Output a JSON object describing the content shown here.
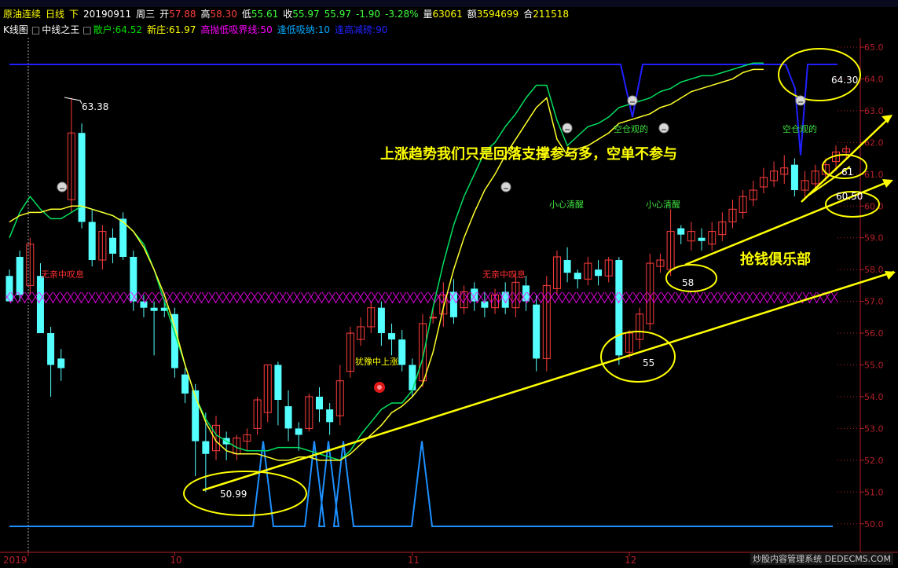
{
  "header": {
    "instrument": "原油连续",
    "period": "日线",
    "direction": "下",
    "date": "20190911",
    "weekday": "周三",
    "open_label": "开",
    "open": "57.88",
    "high_label": "高",
    "high": "58.30",
    "low_label": "低",
    "low": "55.61",
    "close_label": "收",
    "close": "55.97",
    "last": "55.97",
    "change": "-1.90",
    "change_pct": "-3.28%",
    "volume_label": "量",
    "volume": "63061",
    "amount_label": "额",
    "amount": "3594699",
    "oi_label": "合",
    "open_interest": "211518"
  },
  "indicator_bar": {
    "chart_label": "K线图",
    "indicator_name": "中线之王",
    "items": [
      {
        "label": "散户:64.52",
        "color": "#00e000"
      },
      {
        "label": "新庄:61.97",
        "color": "#ffff00"
      },
      {
        "label": "高抛低吸界线:50",
        "color": "#ff00ff"
      },
      {
        "label": "逢低吸纳:10",
        "color": "#00aaff"
      },
      {
        "label": "逢高减磅:90",
        "color": "#2222ff"
      }
    ]
  },
  "colors": {
    "up": "#ff3c3c",
    "down": "#54ffff",
    "axis": "#b4202a",
    "retail_line": "#00e060",
    "banker_line": "#ffff2a",
    "boundary_line": "#ff00ff",
    "low_buy_line": "#1e90ff",
    "high_sell_line": "#2020ff",
    "annotation": "#ffff00"
  },
  "chart_data": {
    "type": "candlestick",
    "ylim": [
      49.8,
      65.2
    ],
    "y_ticks": [
      "50.0",
      "51.0",
      "52.0",
      "53.0",
      "54.0",
      "55.0",
      "56.0",
      "57.0",
      "58.0",
      "59.0",
      "60.0",
      "61.0",
      "62.0",
      "63.0",
      "64.0",
      "65.0"
    ],
    "x_ticks": [
      {
        "label": "2019",
        "index": 0
      },
      {
        "label": "10",
        "index": 16
      },
      {
        "label": "11",
        "index": 39
      },
      {
        "label": "12",
        "index": 60
      }
    ],
    "candles": [
      [
        57.8,
        57.0,
        57.0,
        58.0
      ],
      [
        58.4,
        57.2,
        57.0,
        58.6
      ],
      [
        57.5,
        58.8,
        57.2,
        59.0
      ],
      [
        57.8,
        56.0,
        56.0,
        58.2
      ],
      [
        56.0,
        55.0,
        54.0,
        56.2
      ],
      [
        55.2,
        54.9,
        54.5,
        55.5
      ],
      [
        60.2,
        62.3,
        59.8,
        63.4
      ],
      [
        62.3,
        59.5,
        59.3,
        62.6
      ],
      [
        59.5,
        58.3,
        58.1,
        59.9
      ],
      [
        58.3,
        59.2,
        58.0,
        59.4
      ],
      [
        59.0,
        58.5,
        58.2,
        59.3
      ],
      [
        59.6,
        58.4,
        58.3,
        59.8
      ],
      [
        58.4,
        57.0,
        56.7,
        58.6
      ],
      [
        57.0,
        56.8,
        56.5,
        57.2
      ],
      [
        56.8,
        56.7,
        55.3,
        57.0
      ],
      [
        56.8,
        56.7,
        56.5,
        57.0
      ],
      [
        56.6,
        54.9,
        54.6,
        56.8
      ],
      [
        54.7,
        54.1,
        53.8,
        54.9
      ],
      [
        54.2,
        52.6,
        51.5,
        54.4
      ],
      [
        52.6,
        52.2,
        51.0,
        53.5
      ],
      [
        52.3,
        53.1,
        52.0,
        53.4
      ],
      [
        52.7,
        52.5,
        52.0,
        52.9
      ],
      [
        52.2,
        52.7,
        52.0,
        52.8
      ],
      [
        52.6,
        52.8,
        52.3,
        53.0
      ],
      [
        53.0,
        53.9,
        52.8,
        54.0
      ],
      [
        53.5,
        55.0,
        53.2,
        55.0
      ],
      [
        55.0,
        53.9,
        53.1,
        55.1
      ],
      [
        53.7,
        53.0,
        52.6,
        54.2
      ],
      [
        53.0,
        52.8,
        52.3,
        53.2
      ],
      [
        53.0,
        54.0,
        52.9,
        54.1
      ],
      [
        54.0,
        53.6,
        53.2,
        54.3
      ],
      [
        53.6,
        53.2,
        52.8,
        53.8
      ],
      [
        53.4,
        54.5,
        53.1,
        55.0
      ],
      [
        54.8,
        56.0,
        54.6,
        56.2
      ],
      [
        55.8,
        56.2,
        55.6,
        56.5
      ],
      [
        56.2,
        56.8,
        56.0,
        57.0
      ],
      [
        56.8,
        56.0,
        55.6,
        57.0
      ],
      [
        56.0,
        55.8,
        55.3,
        56.3
      ],
      [
        55.8,
        55.0,
        54.8,
        56.1
      ],
      [
        55.0,
        54.2,
        54.0,
        55.2
      ],
      [
        54.5,
        56.3,
        54.3,
        56.6
      ],
      [
        56.5,
        56.5,
        56.3,
        56.8
      ],
      [
        56.6,
        57.2,
        56.2,
        57.6
      ],
      [
        57.3,
        56.5,
        56.3,
        57.7
      ],
      [
        56.8,
        57.3,
        56.6,
        57.5
      ],
      [
        57.4,
        57.0,
        56.7,
        57.6
      ],
      [
        57.0,
        56.8,
        56.5,
        57.3
      ],
      [
        56.8,
        57.2,
        56.6,
        57.4
      ],
      [
        57.3,
        56.8,
        56.6,
        57.6
      ],
      [
        56.8,
        57.6,
        56.5,
        57.9
      ],
      [
        57.5,
        57.0,
        56.7,
        57.8
      ],
      [
        56.9,
        55.2,
        54.8,
        57.2
      ],
      [
        55.2,
        57.5,
        54.8,
        57.8
      ],
      [
        57.4,
        58.4,
        57.2,
        58.6
      ],
      [
        58.3,
        57.9,
        57.6,
        58.7
      ],
      [
        57.9,
        57.7,
        57.4,
        58.0
      ],
      [
        57.7,
        58.2,
        57.5,
        58.4
      ],
      [
        58.0,
        57.8,
        57.5,
        58.3
      ],
      [
        57.8,
        58.3,
        57.6,
        58.4
      ],
      [
        58.3,
        55.3,
        55.0,
        58.4
      ],
      [
        55.4,
        56.0,
        55.2,
        56.1
      ],
      [
        55.8,
        56.6,
        55.5,
        56.8
      ],
      [
        56.3,
        58.2,
        56.1,
        58.5
      ],
      [
        58.1,
        58.3,
        57.9,
        58.5
      ],
      [
        58.0,
        59.2,
        57.8,
        59.9
      ],
      [
        59.3,
        59.1,
        58.8,
        59.4
      ],
      [
        58.9,
        59.2,
        58.6,
        59.5
      ],
      [
        59.0,
        58.9,
        58.6,
        59.3
      ],
      [
        58.8,
        59.2,
        58.6,
        59.5
      ],
      [
        59.1,
        59.5,
        58.9,
        59.8
      ],
      [
        59.5,
        59.9,
        59.3,
        60.2
      ],
      [
        59.8,
        60.3,
        59.6,
        60.5
      ],
      [
        60.2,
        60.5,
        60.0,
        60.8
      ],
      [
        60.6,
        60.9,
        60.4,
        61.2
      ],
      [
        60.8,
        61.1,
        60.6,
        61.4
      ],
      [
        61.0,
        61.2,
        60.7,
        61.6
      ],
      [
        61.3,
        60.5,
        60.3,
        61.5
      ],
      [
        60.5,
        60.8,
        60.2,
        61.1
      ],
      [
        60.7,
        61.1,
        60.5,
        61.3
      ],
      [
        61.0,
        61.3,
        60.8,
        61.5
      ],
      [
        61.4,
        61.7,
        61.1,
        61.9
      ],
      [
        61.7,
        61.8,
        61.5,
        61.9
      ]
    ],
    "series": [
      {
        "name": "散户",
        "values": [
          59.0,
          59.8,
          60.3,
          59.9,
          59.6,
          59.6,
          59.8,
          60.0,
          59.9,
          59.8,
          59.7,
          59.5,
          59.2,
          58.8,
          58.0,
          57.0,
          56.0,
          55.0,
          54.0,
          53.3,
          52.8,
          52.6,
          52.4,
          52.3,
          52.3,
          52.3,
          52.4,
          52.4,
          52.4,
          52.3,
          52.2,
          52.1,
          52.0,
          52.3,
          52.8,
          53.2,
          53.6,
          53.8,
          53.8,
          54.2,
          55.2,
          56.8,
          58.2,
          59.4,
          60.3,
          61.0,
          61.7,
          62.0,
          62.5,
          62.9,
          63.4,
          63.8,
          63.8,
          62.7,
          61.9,
          62.2,
          62.5,
          62.6,
          62.8,
          63.1,
          63.2,
          63.3,
          63.4,
          63.6,
          63.7,
          63.9,
          64.0,
          64.1,
          64.1,
          64.2,
          64.3,
          64.4,
          64.5,
          64.5
        ]
      },
      {
        "name": "新庄",
        "values": [
          59.5,
          59.7,
          59.8,
          59.8,
          59.9,
          59.9,
          60.0,
          60.0,
          59.9,
          59.8,
          59.7,
          59.5,
          59.2,
          58.7,
          58.0,
          57.2,
          56.2,
          55.0,
          54.0,
          53.2,
          52.6,
          52.3,
          52.2,
          52.2,
          52.2,
          52.1,
          52.0,
          52.0,
          52.1,
          52.1,
          52.0,
          52.0,
          52.0,
          52.2,
          52.5,
          52.8,
          53.1,
          53.5,
          53.7,
          54.0,
          54.4,
          55.4,
          56.8,
          58.0,
          59.0,
          59.8,
          60.5,
          61.0,
          61.6,
          62.1,
          62.6,
          63.1,
          63.4,
          62.1,
          61.6,
          61.8,
          61.9,
          62.1,
          62.3,
          62.6,
          62.7,
          62.8,
          62.9,
          63.1,
          63.2,
          63.4,
          63.6,
          63.7,
          63.8,
          63.9,
          64.0,
          64.2,
          64.3,
          64.3
        ]
      },
      {
        "name": "高抛低吸界线",
        "value": 50
      },
      {
        "name": "逢低吸纳",
        "value": 10
      },
      {
        "name": "逢高减磅",
        "value": 90
      }
    ]
  },
  "annotations": {
    "main_text": "上涨趋势我们只是回落支撑参与多，空单不参与",
    "club_text": "抢钱俱乐部",
    "labels": [
      "无亲中叹息",
      "无亲中叹息",
      "犹豫中上涨",
      "小心清醒",
      "小心清醒",
      "空仓观的",
      "空仓观的"
    ],
    "price_tags": [
      "63.38",
      "50.99",
      "55",
      "58",
      "61",
      "60.50",
      "64.30"
    ]
  },
  "watermark": "炒股内容管理系统  DEDECMS.COM"
}
